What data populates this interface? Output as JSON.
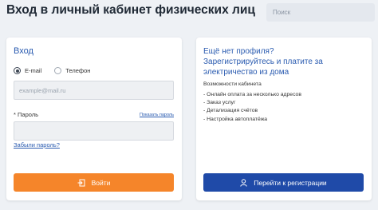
{
  "header": {
    "title": "Вход в личный кабинет физических лиц",
    "search_placeholder": "Поиск"
  },
  "login": {
    "title": "Вход",
    "radio_options": [
      {
        "label": "E-mail",
        "selected": true
      },
      {
        "label": "Телефон",
        "selected": false
      }
    ],
    "email_placeholder": "example@mail.ru",
    "password_label": "* Пароль",
    "show_password_link": "Показать пароль",
    "forgot_password_link": "Забыли пароль?",
    "submit_label": "Войти",
    "submit_color": "#f5852a"
  },
  "register": {
    "title_lines": [
      "Ещё нет профиля?",
      "Зарегистрируйтесь и платите за",
      "электричество из дома"
    ],
    "features_title": "Возможности кабинета",
    "features": [
      "- Онлайн оплата за несколько адресов",
      "- Заказ услуг",
      "- Детализация счётов",
      "- Настройка автоплатёжа"
    ],
    "button_label": "Перейти к регистрации",
    "button_color": "#1f4aa8"
  }
}
